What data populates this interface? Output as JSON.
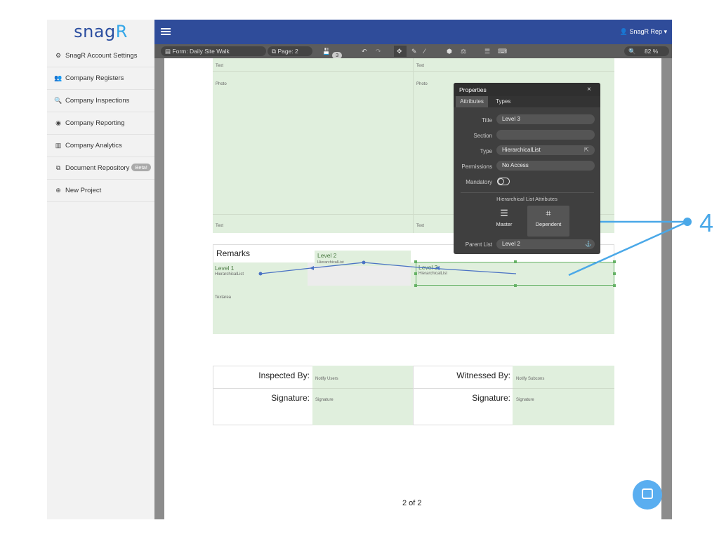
{
  "sidebar": {
    "logo_main": "snag",
    "logo_accent": "R",
    "items": [
      {
        "icon": "cogs-icon",
        "glyph": "⚙",
        "label": "SnagR Account Settings"
      },
      {
        "icon": "users-icon",
        "glyph": "👥",
        "label": "Company Registers"
      },
      {
        "icon": "search-icon",
        "glyph": "🔍",
        "label": "Company Inspections"
      },
      {
        "icon": "globe-icon",
        "glyph": "◉",
        "label": "Company Reporting"
      },
      {
        "icon": "bar-chart-icon",
        "glyph": "▥",
        "label": "Company Analytics"
      },
      {
        "icon": "copy-icon",
        "glyph": "⧉",
        "label": "Document Repository"
      },
      {
        "icon": "plus-circle-icon",
        "glyph": "⊕",
        "label": "New Project"
      }
    ],
    "beta_badge": "Beta!"
  },
  "header": {
    "user_label": "SnagR Rep",
    "user_icon": "user-icon"
  },
  "toolbar": {
    "form_label": "Form: Daily Site Walk",
    "page_label": "Page: 2",
    "save_count": "3",
    "zoom_label": "82 %"
  },
  "form": {
    "top_text_left": "Text",
    "top_text_right": "Text",
    "photo_left": "Photo",
    "photo_right": "Photo",
    "bottom_text_left": "Text",
    "bottom_text_right": "Text",
    "remarks": "Remarks",
    "level1": "Level 1",
    "level1_type": "HierarchicalList",
    "level2": "Level 2",
    "level2_type": "HierarchicalList",
    "level3": "Level 3",
    "level3_type": "HierarchicalList",
    "textarea": "Textarea",
    "inspected_by": "Inspected By:",
    "notify_users": "Notify Users",
    "witnessed_by": "Witnessed By:",
    "notify_subcons": "Notify Subcons",
    "signature_left": "Signature:",
    "signature_left_field": "Signature",
    "signature_right": "Signature:",
    "signature_right_field": "Signature",
    "page_number": "2 of 2"
  },
  "properties": {
    "title": "Properties",
    "tab_attributes": "Attributes",
    "tab_types": "Types",
    "title_label": "Title",
    "title_value": "Level 3",
    "section_label": "Section",
    "section_value": "",
    "type_label": "Type",
    "type_value": "HierarchicalList",
    "permissions_label": "Permissions",
    "permissions_value": "No Access",
    "mandatory_label": "Mandatory",
    "hl_heading": "Hierarchical List Attributes",
    "master_label": "Master",
    "dependent_label": "Dependent",
    "parent_list_label": "Parent List",
    "parent_list_value": "Level 2"
  },
  "callout": "4",
  "colors": {
    "header": "#2f4c9a",
    "accent": "#4aa8e8",
    "field_green": "#e0efdd"
  }
}
